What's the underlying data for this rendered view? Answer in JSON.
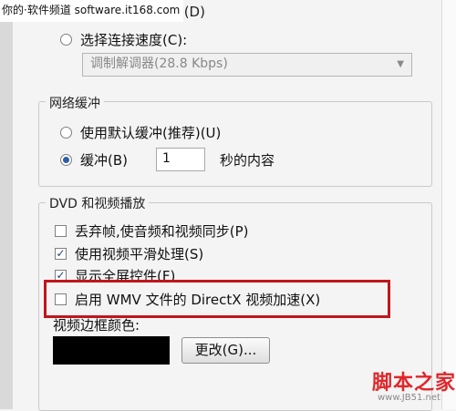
{
  "watermark": {
    "text": "你的·软件频道 software.it168.com"
  },
  "top_cut_label": "(推荐)(D)",
  "connection": {
    "radio_label": "选择连接速度(C):",
    "speed_select": {
      "value": "调制解调器(28.8 Kbps)"
    }
  },
  "buffer": {
    "title": "网络缓冲",
    "default_label": "使用默认缓冲(推荐)(U)",
    "buffer_label": "缓冲(B)",
    "buffer_value": "1",
    "seconds_label": "秒的内容"
  },
  "dvd": {
    "title": "DVD 和视频播放",
    "drop_frames_label": "丢弃帧,使音频和视频同步(P)",
    "drop_frames_checked": false,
    "smoothing_label": "使用视频平滑处理(S)",
    "smoothing_checked": true,
    "fullscreen_controls_label": "显示全屏控件(F)",
    "fullscreen_controls_checked": true,
    "directx_label": "启用 WMV 文件的 DirectX 视频加速(X)",
    "directx_checked": false,
    "border_color_label": "视频边框颜色:",
    "border_color": "#000000",
    "change_button": "更改(G)..."
  },
  "logo": {
    "name": "脚本之家",
    "url": "www.JB51.net"
  },
  "colors": {
    "highlight": "#c0161b",
    "logo": "#e0262a",
    "radio_fill": "#2d5ea8"
  }
}
